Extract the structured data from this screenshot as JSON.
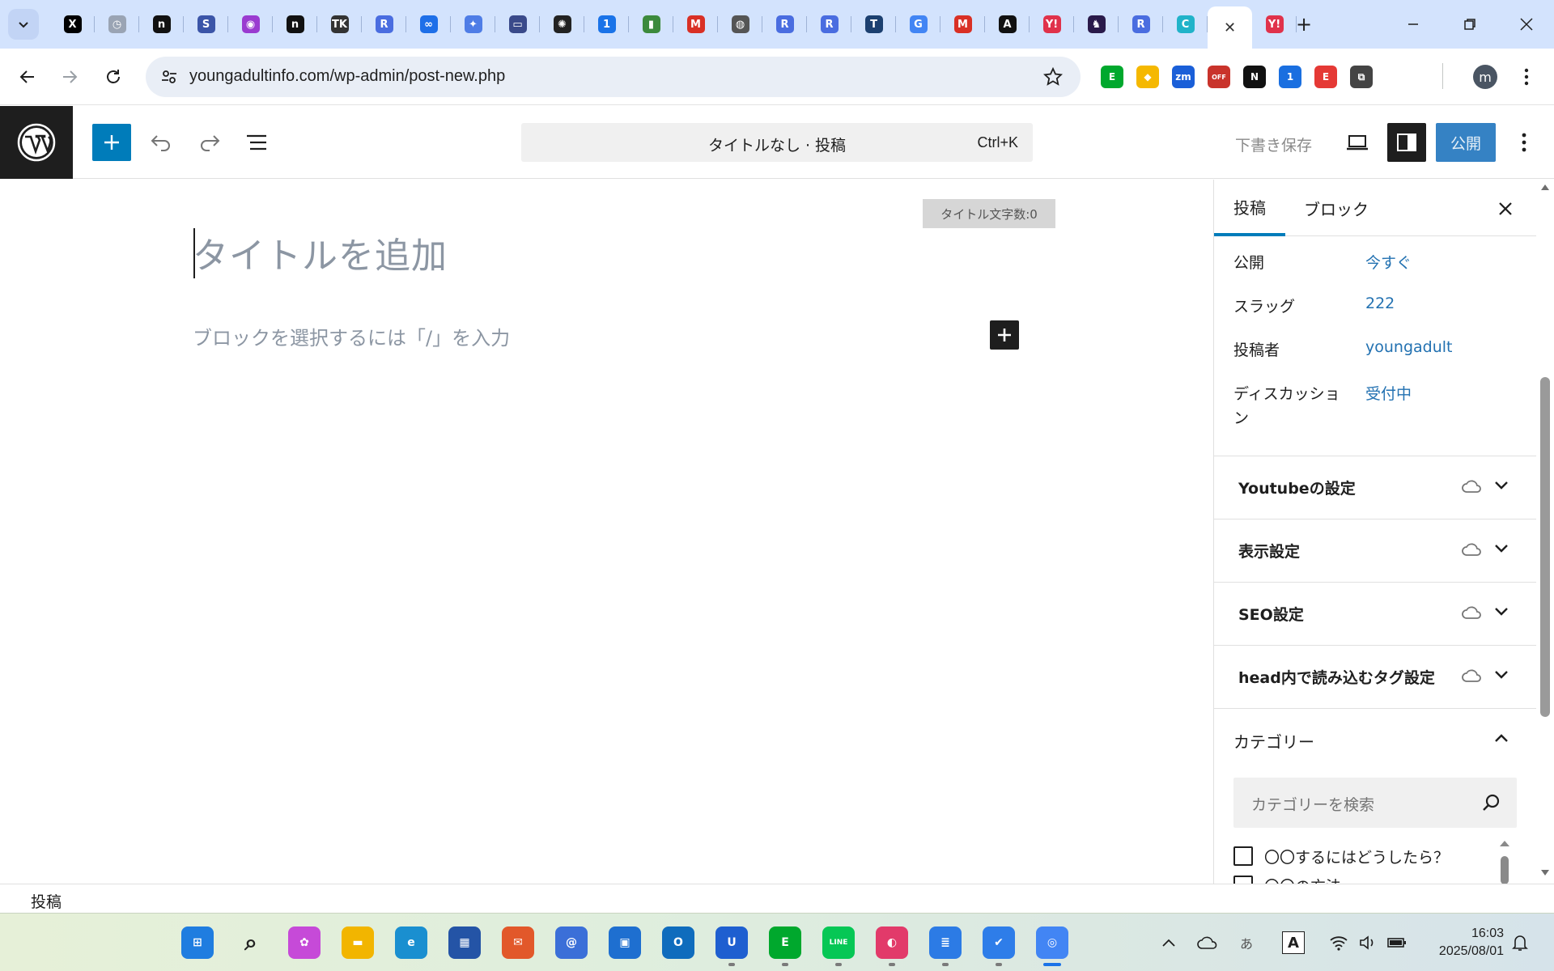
{
  "browser": {
    "url": "youngadultinfo.com/wp-admin/post-new.php",
    "tabs": [
      {
        "icon": "x-icon",
        "glyph": "X",
        "color": "#000000"
      },
      {
        "icon": "clock-icon",
        "glyph": "◷",
        "color": "#9aa4b4"
      },
      {
        "icon": "note-icon",
        "glyph": "n",
        "color": "#111111"
      },
      {
        "icon": "s-icon",
        "glyph": "S",
        "color": "#3b55a8"
      },
      {
        "icon": "podcast-icon",
        "glyph": "◉",
        "color": "#9a3bd0"
      },
      {
        "icon": "note-icon",
        "glyph": "n",
        "color": "#111111"
      },
      {
        "icon": "tk-icon",
        "glyph": "TK",
        "color": "#333333"
      },
      {
        "icon": "r-icon",
        "glyph": "R",
        "color": "#4a6de0"
      },
      {
        "icon": "infinity-icon",
        "glyph": "∞",
        "color": "#1e6fe8"
      },
      {
        "icon": "sparkle-icon",
        "glyph": "✦",
        "color": "#4f7de6"
      },
      {
        "icon": "laptop-icon",
        "glyph": "▭",
        "color": "#3a4a8a"
      },
      {
        "icon": "openai-icon",
        "glyph": "✺",
        "color": "#222222"
      },
      {
        "icon": "calendar-icon",
        "glyph": "1",
        "color": "#1a73e8"
      },
      {
        "icon": "book-icon",
        "glyph": "▮",
        "color": "#3c8a3c"
      },
      {
        "icon": "gmail-icon",
        "glyph": "M",
        "color": "#d93025"
      },
      {
        "icon": "globe-icon",
        "glyph": "◍",
        "color": "#555555"
      },
      {
        "icon": "r-icon",
        "glyph": "R",
        "color": "#4a6de0"
      },
      {
        "icon": "r-icon",
        "glyph": "R",
        "color": "#4a6de0"
      },
      {
        "icon": "t-icon",
        "glyph": "T",
        "color": "#1c4070"
      },
      {
        "icon": "translate-icon",
        "glyph": "G",
        "color": "#4285f4"
      },
      {
        "icon": "gmail-icon",
        "glyph": "M",
        "color": "#d93025"
      },
      {
        "icon": "font-icon",
        "glyph": "A",
        "color": "#111111"
      },
      {
        "icon": "yahoo-icon",
        "glyph": "Y!",
        "color": "#e0324b"
      },
      {
        "icon": "horse-icon",
        "glyph": "♞",
        "color": "#2a1a4a"
      },
      {
        "icon": "r-icon",
        "glyph": "R",
        "color": "#4a6de0"
      },
      {
        "icon": "c-icon",
        "glyph": "C",
        "color": "#21b3c9"
      },
      {
        "icon": "close-icon",
        "glyph": "✕",
        "color": "#333333"
      },
      {
        "icon": "yahoo-icon",
        "glyph": "Y!",
        "color": "#e0324b"
      }
    ],
    "extensions": [
      {
        "icon": "evernote-icon",
        "glyph": "E",
        "color": "#00a82d"
      },
      {
        "icon": "keep-icon",
        "glyph": "◆",
        "color": "#f5b800"
      },
      {
        "icon": "zoom-icon",
        "glyph": "zm",
        "color": "#1a5fd8"
      },
      {
        "icon": "off-icon",
        "glyph": "OFF",
        "color": "#c9332b"
      },
      {
        "icon": "notion-icon",
        "glyph": "N",
        "color": "#111111"
      },
      {
        "icon": "onepassword-icon",
        "glyph": "1",
        "color": "#1a6fe0"
      },
      {
        "icon": "e-icon",
        "glyph": "E",
        "color": "#e53935"
      },
      {
        "icon": "extensions-icon",
        "glyph": "⧉",
        "color": "#444444"
      }
    ],
    "profile_initial": "m"
  },
  "editor": {
    "document_title": "タイトルなし · 投稿",
    "shortcut": "Ctrl+K",
    "save_draft": "下書き保存",
    "publish": "公開",
    "title_count": "タイトル文字数:0",
    "title_placeholder": "タイトルを追加",
    "block_placeholder": "ブロックを選択するには「/」を入力"
  },
  "sidebar": {
    "tabs": [
      "投稿",
      "ブロック"
    ],
    "meta": [
      {
        "label": "公開",
        "value": "今すぐ"
      },
      {
        "label": "スラッグ",
        "value": "222"
      },
      {
        "label": "投稿者",
        "value": "youngadult"
      },
      {
        "label": "ディスカッション",
        "value": "受付中"
      }
    ],
    "panels": [
      {
        "title": "Youtubeの設定"
      },
      {
        "title": "表示設定"
      },
      {
        "title": "SEO設定"
      },
      {
        "title": "head内で読み込むタグ設定"
      }
    ],
    "categories": {
      "title": "カテゴリー",
      "search_placeholder": "カテゴリーを検索",
      "items": [
        "〇〇するにはどうしたら？",
        "〇〇の方法"
      ]
    }
  },
  "footer": {
    "breadcrumb": "投稿"
  },
  "taskbar": {
    "time": "16:03",
    "date": "2025/08/01",
    "apps": [
      {
        "icon": "windows-start-icon",
        "glyph": "⊞",
        "color": "#1f7de0"
      },
      {
        "icon": "search-icon",
        "glyph": "⌕",
        "color": "#222222"
      },
      {
        "icon": "copilot-icon",
        "glyph": "✿",
        "color": "#c64ad8"
      },
      {
        "icon": "file-explorer-icon",
        "glyph": "▬",
        "color": "#f2b500"
      },
      {
        "icon": "edge-icon",
        "glyph": "e",
        "color": "#1a8fd0"
      },
      {
        "icon": "store-icon",
        "glyph": "▦",
        "color": "#2454a6"
      },
      {
        "icon": "mail-app-icon",
        "glyph": "✉",
        "color": "#e2582a"
      },
      {
        "icon": "mail-at-icon",
        "glyph": "@",
        "color": "#3b6fd8"
      },
      {
        "icon": "photo-icon",
        "glyph": "▣",
        "color": "#1e6fd0"
      },
      {
        "icon": "outlook-icon",
        "glyph": "O",
        "color": "#0f6cbd"
      },
      {
        "icon": "u-app-icon",
        "glyph": "U",
        "color": "#1e5fd0"
      },
      {
        "icon": "evernote-icon",
        "glyph": "E",
        "color": "#00a82d"
      },
      {
        "icon": "line-icon",
        "glyph": "LINE",
        "color": "#06c755"
      },
      {
        "icon": "pie-app-icon",
        "glyph": "◐",
        "color": "#e23a6a"
      },
      {
        "icon": "notepad-icon",
        "glyph": "≣",
        "color": "#2c7be5"
      },
      {
        "icon": "todo-icon",
        "glyph": "✔",
        "color": "#2e7de9"
      },
      {
        "icon": "chrome-icon",
        "glyph": "◎",
        "color": "#4285f4"
      }
    ]
  }
}
